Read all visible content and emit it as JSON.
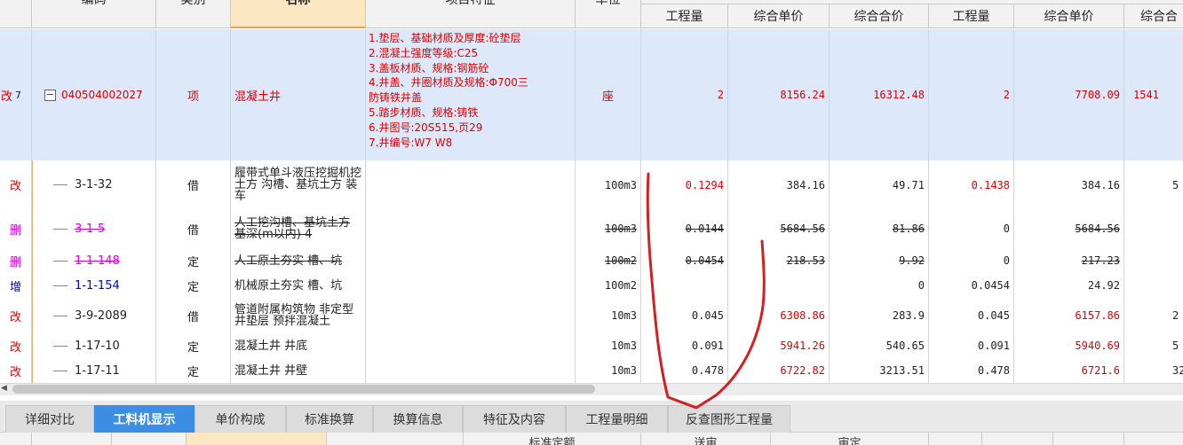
{
  "header": {
    "code": "编码",
    "type": "类别",
    "name": "名称",
    "feature": "项目特征",
    "unit": "单位",
    "qty1": "工程量",
    "price1": "综合单价",
    "total1": "综合合价",
    "qty2": "工程量",
    "price2": "综合单价",
    "total2": "综合合"
  },
  "main_row": {
    "status": "改",
    "index": "7",
    "toggle": "−",
    "code": "040504002027",
    "type": "项",
    "name": "混凝土井",
    "feature": [
      "1.垫层、基础材质及厚度:砼垫层",
      "2.混凝土强度等级:C25",
      "3.盖板材质、规格:钢筋砼",
      "4.井盖、井圈材质及规格:Φ700三",
      "防铸铁井盖",
      "5.踏步材质、规格:铸铁",
      "6.井图号:20S515,页29",
      "7.井编号:W7 W8"
    ],
    "unit": "座",
    "qty1": "2",
    "price1": "8156.24",
    "total1": "16312.48",
    "qty2": "2",
    "price2": "7708.09",
    "total2": "1541"
  },
  "rows": [
    {
      "status": "改",
      "code": "3-1-32",
      "type": "借",
      "name": "履带式单斗液压挖掘机挖土方 沟槽、基坑土方 装车",
      "unit": "100m3",
      "qty1": "0.1294",
      "price1": "384.16",
      "total1": "49.71",
      "qty2": "0.1438",
      "price2": "384.16",
      "total2": "5"
    },
    {
      "status": "删",
      "code": "3-1-5",
      "type": "借",
      "name": "人工挖沟槽、基坑土方 基深(m以内) 4",
      "unit": "100m3",
      "qty1": "0.0144",
      "price1": "5684.56",
      "total1": "81.86",
      "qty2": "0",
      "price2": "5684.56",
      "total2": ""
    },
    {
      "status": "删",
      "code": "1-1-148",
      "type": "定",
      "name": "人工原土夯实 槽、坑",
      "unit": "100m2",
      "qty1": "0.0454",
      "price1": "218.53",
      "total1": "9.92",
      "qty2": "0",
      "price2": "217.23",
      "total2": ""
    },
    {
      "status": "增",
      "code": "1-1-154",
      "type": "定",
      "name": "机械原土夯实 槽、坑",
      "unit": "100m2",
      "qty1": "",
      "price1": "",
      "total1": "0",
      "qty2": "0.0454",
      "price2": "24.92",
      "total2": ""
    },
    {
      "status": "改",
      "code": "3-9-2089",
      "type": "借",
      "name": "管道附属构筑物 非定型井垫层 预拌混凝土",
      "unit": "10m3",
      "qty1": "0.045",
      "price1": "6308.86",
      "total1": "283.9",
      "qty2": "0.045",
      "price2": "6157.86",
      "total2": "2"
    },
    {
      "status": "改",
      "code": "1-17-10",
      "type": "定",
      "name": "混凝土井 井底",
      "unit": "10m3",
      "qty1": "0.091",
      "price1": "5941.26",
      "total1": "540.65",
      "qty2": "0.091",
      "price2": "5940.69",
      "total2": "5"
    },
    {
      "status": "改",
      "code": "1-17-11",
      "type": "定",
      "name": "混凝土井 井壁",
      "unit": "10m3",
      "qty1": "0.478",
      "price1": "6722.82",
      "total1": "3213.51",
      "qty2": "0.478",
      "price2": "6721.6",
      "total2": "321"
    }
  ],
  "tabs": [
    "详细对比",
    "工料机显示",
    "单价构成",
    "标准换算",
    "换算信息",
    "特征及内容",
    "工程量明细",
    "反查图形工程量"
  ],
  "active_tab": "工料机显示",
  "bottom_header": [
    "标准定额",
    "送审",
    "审定"
  ],
  "colors": {
    "status_red": "#e00000",
    "status_magenta": "#e000e0",
    "status_blue": "#0000d0",
    "tab_active": "#3c8ee4",
    "highlight_row": "#dde8fb",
    "annotation": "#d42020"
  },
  "scroll_arrow": "◀"
}
